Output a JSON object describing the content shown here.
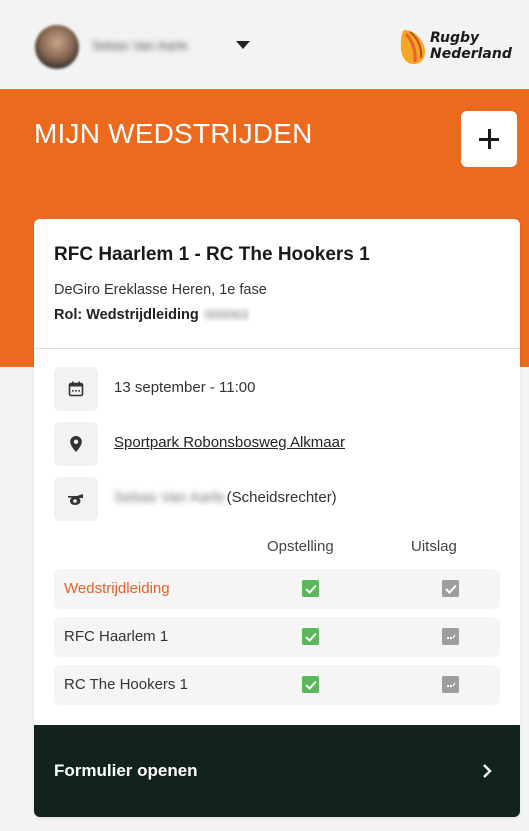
{
  "header": {
    "user_name": "Sebas Van Aarle",
    "logo_line1": "Rugby",
    "logo_line2": "Nederland"
  },
  "page": {
    "title": "MIJN WEDSTRIJDEN",
    "add_label": "+"
  },
  "match": {
    "title": "RFC Haarlem 1 - RC The Hookers 1",
    "competition": "DeGiro Ereklasse Heren, 1e fase",
    "role_label": "Rol: Wedstrijdleiding",
    "role_id": "000063",
    "date": "13 september - 11:00",
    "venue": "Sportpark Robonsbosweg Alkmaar",
    "official_name": "Sebas Van Aarle",
    "official_role": "(Scheidsrechter)"
  },
  "table": {
    "col_lineup": "Opstelling",
    "col_result": "Uitslag",
    "rows": [
      {
        "label": "Wedstrijdleiding",
        "lineup": "checked",
        "result": "checked-grey"
      },
      {
        "label": "RFC Haarlem 1",
        "lineup": "checked",
        "result": "pending"
      },
      {
        "label": "RC The Hookers 1",
        "lineup": "checked",
        "result": "pending"
      }
    ]
  },
  "footer": {
    "open_form_label": "Formulier openen"
  },
  "colors": {
    "brand_orange": "#ec6a1e",
    "accent_text": "#e8602a",
    "check_green": "#5cb85c",
    "check_grey": "#9e9e9e",
    "footer_bg": "#12221c"
  },
  "icons": {
    "user_caret": "caret-down-icon",
    "add": "plus-icon",
    "date": "calendar-icon",
    "venue": "location-pin-icon",
    "official": "whistle-icon",
    "footer": "chevron-right-icon"
  }
}
